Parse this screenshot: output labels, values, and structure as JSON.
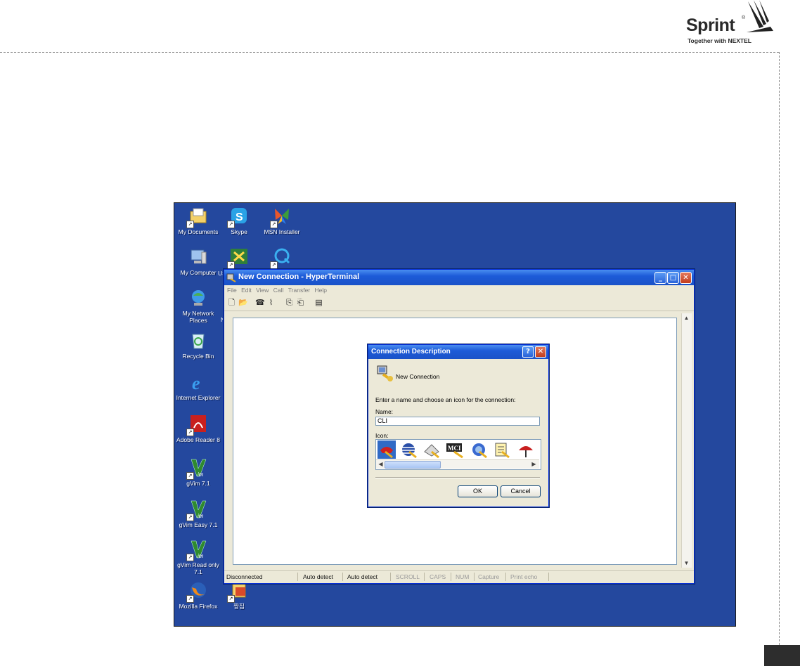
{
  "header": {
    "brand": "Sprint",
    "brand_mark": "®",
    "tagline": "Together with NEXTEL"
  },
  "desktop": {
    "icons": [
      {
        "label": "My Documents"
      },
      {
        "label": "Skype"
      },
      {
        "label": "MSN Installer"
      },
      {
        "label": "My Computer"
      },
      {
        "label": "US"
      },
      {
        "label": "My Network Places"
      },
      {
        "label": "N"
      },
      {
        "label": "Recycle Bin"
      },
      {
        "label": "Internet Explorer"
      },
      {
        "label": "Adobe Reader 8"
      },
      {
        "label": "gVim 7.1"
      },
      {
        "label": "gVim Easy 7.1"
      },
      {
        "label": "gVim Read only 7.1"
      },
      {
        "label": "Mozilla Firefox"
      },
      {
        "label": "짱짐"
      }
    ]
  },
  "window": {
    "title": "New Connection - HyperTerminal",
    "menu": [
      "File",
      "Edit",
      "View",
      "Call",
      "Transfer",
      "Help"
    ],
    "status": {
      "connection": "Disconnected",
      "detect1": "Auto detect",
      "detect2": "Auto detect",
      "scroll": "SCROLL",
      "caps": "CAPS",
      "num": "NUM",
      "capture": "Capture",
      "print": "Print echo"
    }
  },
  "dialog": {
    "title": "Connection Description",
    "heading": "New Connection",
    "prompt": "Enter a name and choose an icon for the connection:",
    "name_label": "Name:",
    "name_value": "CLI",
    "icon_label": "Icon:",
    "icon_mci": "MCI",
    "ok": "OK",
    "cancel": "Cancel"
  },
  "colors": {
    "desktop": "#24489e",
    "titlebar": "#1d5bd8"
  }
}
